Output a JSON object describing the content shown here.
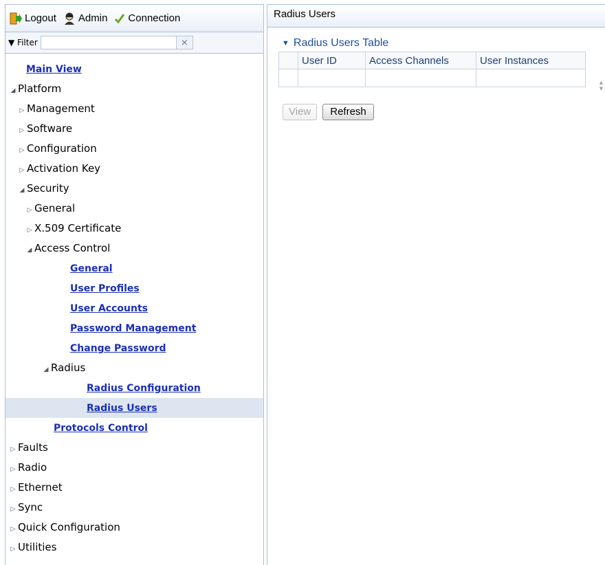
{
  "top_nav": {
    "logout": "Logout",
    "admin": "Admin",
    "connection": "Connection"
  },
  "filter": {
    "label": "▼ Filter",
    "value": "",
    "clear": "×"
  },
  "tree": [
    {
      "label": "Main View",
      "level": 0,
      "type": "link"
    },
    {
      "label": "Platform",
      "level": 0,
      "type": "expanded"
    },
    {
      "label": "Management",
      "level": 1,
      "type": "collapsed"
    },
    {
      "label": "Software",
      "level": 1,
      "type": "collapsed"
    },
    {
      "label": "Configuration",
      "level": 1,
      "type": "collapsed"
    },
    {
      "label": "Activation Key",
      "level": 1,
      "type": "collapsed"
    },
    {
      "label": "Security",
      "level": 1,
      "type": "expanded"
    },
    {
      "label": "General",
      "level": 2,
      "type": "collapsed"
    },
    {
      "label": "X.509 Certificate",
      "level": 2,
      "type": "collapsed"
    },
    {
      "label": "Access Control",
      "level": 2,
      "type": "expanded"
    },
    {
      "label": "General",
      "level": 3,
      "type": "link"
    },
    {
      "label": "User Profiles",
      "level": 3,
      "type": "link"
    },
    {
      "label": "User Accounts",
      "level": 3,
      "type": "link"
    },
    {
      "label": "Password Management",
      "level": 3,
      "type": "link"
    },
    {
      "label": "Change Password",
      "level": 3,
      "type": "link"
    },
    {
      "label": "Radius",
      "level": 3,
      "type": "expanded"
    },
    {
      "label": "Radius Configuration",
      "level": 4,
      "type": "link"
    },
    {
      "label": "Radius Users",
      "level": 4,
      "type": "link",
      "selected": true
    },
    {
      "label": "Protocols Control",
      "level": 2,
      "type": "link"
    },
    {
      "label": "Faults",
      "level": 0,
      "type": "collapsed"
    },
    {
      "label": "Radio",
      "level": 0,
      "type": "collapsed"
    },
    {
      "label": "Ethernet",
      "level": 0,
      "type": "collapsed"
    },
    {
      "label": "Sync",
      "level": 0,
      "type": "collapsed"
    },
    {
      "label": "Quick Configuration",
      "level": 0,
      "type": "collapsed"
    },
    {
      "label": "Utilities",
      "level": 0,
      "type": "collapsed"
    }
  ],
  "page": {
    "title": "Radius Users",
    "section_title": "Radius Users Table",
    "columns": [
      "User ID",
      "Access Channels",
      "User Instances"
    ],
    "view_button": "View",
    "refresh_button": "Refresh"
  },
  "colors": {
    "link": "#1a2fb5",
    "section": "#1e4f99",
    "selected_row": "#dde6f0",
    "panel_border": "#a9bfd6"
  }
}
